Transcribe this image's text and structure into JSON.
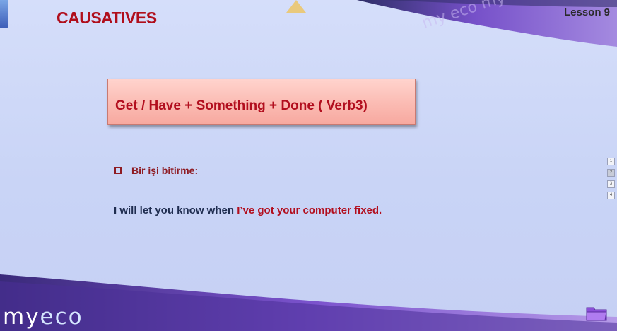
{
  "header": {
    "title": "CAUSATIVES",
    "lesson": "Lesson 9"
  },
  "content": {
    "formula": "Get / Have + Something + Done ( Verb3)",
    "bullet": "Bir işi bitirme:",
    "sentence_plain": "I will let you know when ",
    "sentence_highlight": "I’ve got your computer fixed."
  },
  "nav": {
    "items": [
      {
        "label": "1",
        "active": false
      },
      {
        "label": "2",
        "active": true
      },
      {
        "label": "3",
        "active": false
      },
      {
        "label": "4",
        "active": false
      }
    ]
  },
  "footer": {
    "logo_prefix": "my",
    "logo_suffix": "eco"
  },
  "icons": {
    "folder": "folder-icon"
  },
  "colors": {
    "title_red": "#b00e1c",
    "background": "#ccd6f7",
    "banner_purple": "#6a3fb8",
    "formula_box": "#fbbdb5"
  }
}
